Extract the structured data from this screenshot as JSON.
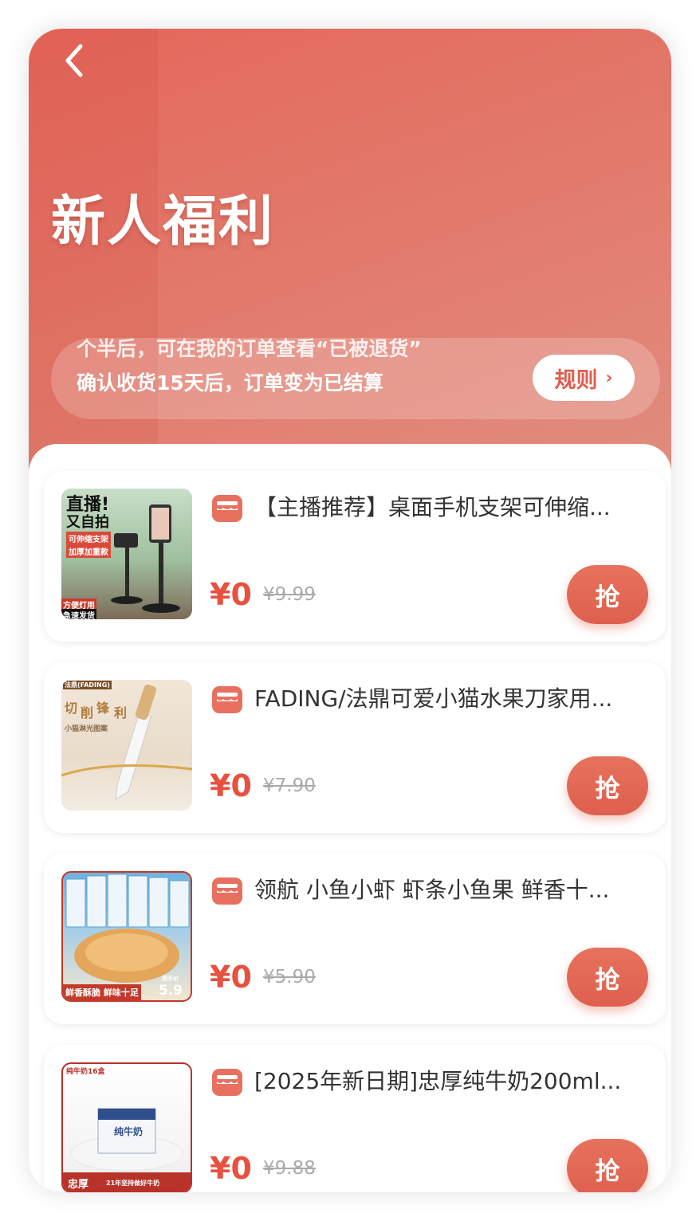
{
  "header": {
    "back_icon": "chevron-left-icon",
    "title": "新人福利",
    "notice_line1": "个半后，可在我的订单查看“已被退货”",
    "notice_line2": "确认收货15天后，订单变为已结算",
    "rules_label": "规则",
    "rules_chevron": "›"
  },
  "colors": {
    "accent": "#e05d4e",
    "price": "#e8503f",
    "hero_start": "#e4675b",
    "hero_end": "#e08e80"
  },
  "products": [
    {
      "title": "【主播推荐】桌面手机支架可伸缩...",
      "price": "¥0",
      "original_price": "¥9.99",
      "button": "抢",
      "thumb_text": [
        "直播!",
        "又自拍",
        "可伸缩支架",
        "加厚加重款",
        "方便灯用",
        "急速发货"
      ]
    },
    {
      "title": "FADING/法鼎可爱小猫水果刀家用...",
      "price": "¥0",
      "original_price": "¥7.90",
      "button": "抢",
      "thumb_text": [
        "法鼎(FADING)",
        "切",
        "削",
        "锋",
        "利",
        "小猫淋光图案"
      ]
    },
    {
      "title": "领航 小鱼小虾 虾条小鱼果 鲜香十...",
      "price": "¥0",
      "original_price": "¥5.90",
      "button": "抢",
      "thumb_text": [
        "鲜香酥脆 鲜味十足",
        "到手价",
        "5.9"
      ]
    },
    {
      "title": "[2025年新日期]忠厚纯牛奶200ml...",
      "price": "¥0",
      "original_price": "¥9.88",
      "button": "抢",
      "thumb_text": [
        "纯牛奶16盒",
        "纯牛奶",
        "忠厚",
        "21年坚持做好牛奶"
      ]
    }
  ]
}
